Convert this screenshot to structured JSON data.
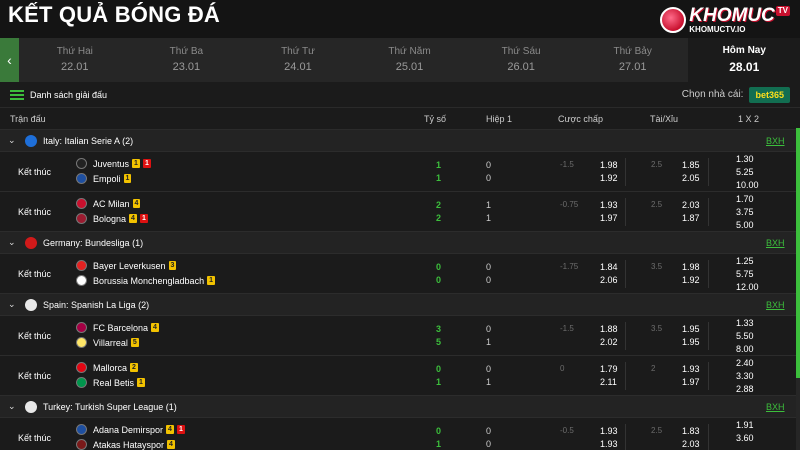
{
  "page": {
    "title": "KẾT QUẢ BÓNG ĐÁ"
  },
  "logo": {
    "main": "KHOMUC",
    "tv": "TV",
    "sub": "KHOMUCTV.IO"
  },
  "dates": [
    {
      "day": "Thứ Hai",
      "date": "22.01"
    },
    {
      "day": "Thứ Ba",
      "date": "23.01"
    },
    {
      "day": "Thứ Tư",
      "date": "24.01"
    },
    {
      "day": "Thứ Năm",
      "date": "25.01"
    },
    {
      "day": "Thứ Sáu",
      "date": "26.01"
    },
    {
      "day": "Thứ Bảy",
      "date": "27.01"
    },
    {
      "day": "Hôm Nay",
      "date": "28.01",
      "active": true
    }
  ],
  "date_arrow": "‹",
  "toolbar": {
    "league_list": "Danh sách giải đấu",
    "provider_label": "Chọn nhà cái:",
    "provider": "bet365"
  },
  "columns": {
    "match": "Trận đấu",
    "score": "Tỷ số",
    "half": "Hiệp 1",
    "handicap": "Cược chấp",
    "overunder": "Tài/Xỉu",
    "x12": "1 X 2"
  },
  "leagues": [
    {
      "country": "Italy:",
      "name": "Italian Serie A",
      "count": "(2)",
      "bxh": "BXH",
      "flag_color": "#1e6fd9",
      "matches": [
        {
          "status": "Kết thúc",
          "home": {
            "name": "Juventus",
            "crest": "#222222",
            "cards": [
              {
                "type": "y",
                "n": "1"
              },
              {
                "type": "r",
                "n": "1"
              }
            ]
          },
          "away": {
            "name": "Empoli",
            "crest": "#1e4fa0",
            "cards": [
              {
                "type": "y",
                "n": "1"
              }
            ]
          },
          "score": [
            "1",
            "1"
          ],
          "ht": [
            "0",
            "0"
          ],
          "hline": "-1.5",
          "hodds": [
            "1.98",
            "1.92"
          ],
          "tline": "2.5",
          "todds": [
            "1.85",
            "2.05"
          ],
          "x12": [
            "1.30",
            "5.25",
            "10.00"
          ]
        },
        {
          "status": "Kết thúc",
          "home": {
            "name": "AC Milan",
            "crest": "#c8102e",
            "cards": [
              {
                "type": "y",
                "n": "4"
              }
            ]
          },
          "away": {
            "name": "Bologna",
            "crest": "#9b1b30",
            "cards": [
              {
                "type": "y",
                "n": "4"
              },
              {
                "type": "r",
                "n": "1"
              }
            ]
          },
          "score": [
            "2",
            "2"
          ],
          "ht": [
            "1",
            "1"
          ],
          "hline": "-0.75",
          "hodds": [
            "1.93",
            "1.97"
          ],
          "tline": "2.5",
          "todds": [
            "2.03",
            "1.87"
          ],
          "x12": [
            "1.70",
            "3.75",
            "5.00"
          ]
        }
      ]
    },
    {
      "country": "Germany:",
      "name": "Bundesliga",
      "count": "(1)",
      "bxh": "BXH",
      "flag_color": "#d11a1a",
      "matches": [
        {
          "status": "Kết thúc",
          "home": {
            "name": "Bayer Leverkusen",
            "crest": "#e32221",
            "cards": [
              {
                "type": "y",
                "n": "3"
              }
            ]
          },
          "away": {
            "name": "Borussia Monchengladbach",
            "crest": "#ffffff",
            "cards": [
              {
                "type": "y",
                "n": "1"
              }
            ]
          },
          "score": [
            "0",
            "0"
          ],
          "ht": [
            "0",
            "0"
          ],
          "hline": "-1.75",
          "hodds": [
            "1.84",
            "2.06"
          ],
          "tline": "3.5",
          "todds": [
            "1.98",
            "1.92"
          ],
          "x12": [
            "1.25",
            "5.75",
            "12.00"
          ]
        }
      ]
    },
    {
      "country": "Spain:",
      "name": "Spanish La Liga",
      "count": "(2)",
      "bxh": "BXH",
      "flag_color": "#e8e8e8",
      "matches": [
        {
          "status": "Kết thúc",
          "home": {
            "name": "FC Barcelona",
            "crest": "#a50044",
            "cards": [
              {
                "type": "y",
                "n": "4"
              }
            ]
          },
          "away": {
            "name": "Villarreal",
            "crest": "#ffe667",
            "cards": [
              {
                "type": "y",
                "n": "5"
              }
            ]
          },
          "score": [
            "3",
            "5"
          ],
          "ht": [
            "0",
            "1"
          ],
          "hline": "-1.5",
          "hodds": [
            "1.88",
            "2.02"
          ],
          "tline": "3.5",
          "todds": [
            "1.95",
            "1.95"
          ],
          "x12": [
            "1.33",
            "5.50",
            "8.00"
          ]
        },
        {
          "status": "Kết thúc",
          "home": {
            "name": "Mallorca",
            "crest": "#e20613",
            "cards": [
              {
                "type": "y",
                "n": "2"
              }
            ]
          },
          "away": {
            "name": "Real Betis",
            "crest": "#00954c",
            "cards": [
              {
                "type": "y",
                "n": "1"
              }
            ]
          },
          "score": [
            "0",
            "1"
          ],
          "ht": [
            "0",
            "1"
          ],
          "hline": "0",
          "hodds": [
            "1.79",
            "2.11"
          ],
          "tline": "2",
          "todds": [
            "1.93",
            "1.97"
          ],
          "x12": [
            "2.40",
            "3.30",
            "2.88"
          ]
        }
      ]
    },
    {
      "country": "Turkey:",
      "name": "Turkish Super League",
      "count": "(1)",
      "bxh": "BXH",
      "flag_color": "#e8e8e8",
      "matches": [
        {
          "status": "Kết thúc",
          "home": {
            "name": "Adana Demirspor",
            "crest": "#1e4fa0",
            "cards": [
              {
                "type": "y",
                "n": "4"
              },
              {
                "type": "r",
                "n": "1"
              }
            ]
          },
          "away": {
            "name": "Atakas Hatayspor",
            "crest": "#7a1a1a",
            "cards": [
              {
                "type": "y",
                "n": "4"
              }
            ]
          },
          "score": [
            "0",
            "1"
          ],
          "ht": [
            "0",
            "0"
          ],
          "hline": "-0.5",
          "hodds": [
            "1.93",
            "1.93"
          ],
          "tline": "2.5",
          "todds": [
            "1.83",
            "2.03"
          ],
          "x12": [
            "1.91",
            "3.60",
            ""
          ]
        }
      ]
    }
  ]
}
